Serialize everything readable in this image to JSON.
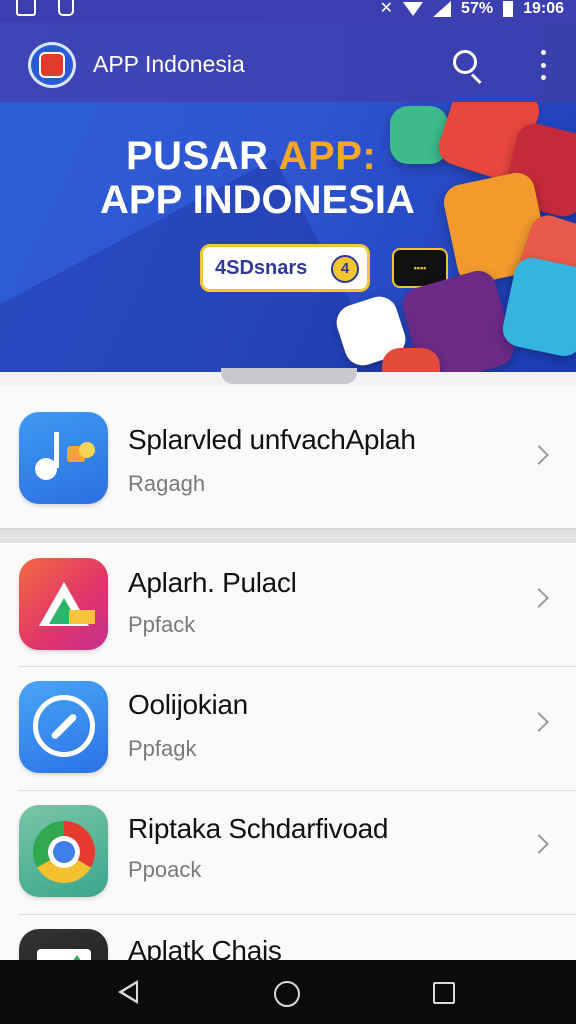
{
  "status_bar": {
    "battery_text": "57%",
    "time": "19:06"
  },
  "app_bar": {
    "title": "APP Indonesia"
  },
  "banner": {
    "title_line1_a": "PUSAR",
    "title_line1_b": "APP:",
    "title_line2": "APP INDONESIA",
    "pill_text": "4SDsnars",
    "pill_badge": "4"
  },
  "featured": {
    "title": "Splarvled unfvachAplah",
    "subtitle": "Ragagh"
  },
  "apps": [
    {
      "title": "Aplarh. Pulacl",
      "subtitle": "Ppfack"
    },
    {
      "title": "Oolijokian",
      "subtitle": "Ppfagk"
    },
    {
      "title": "Riptaka Schdarfivoad",
      "subtitle": "Ppoack"
    },
    {
      "title": "Aplatk Chais",
      "subtitle": ""
    }
  ],
  "colors": {
    "app_bar": "#3f45b8",
    "banner": "#2d5ed8",
    "accent": "#f6a72a"
  }
}
